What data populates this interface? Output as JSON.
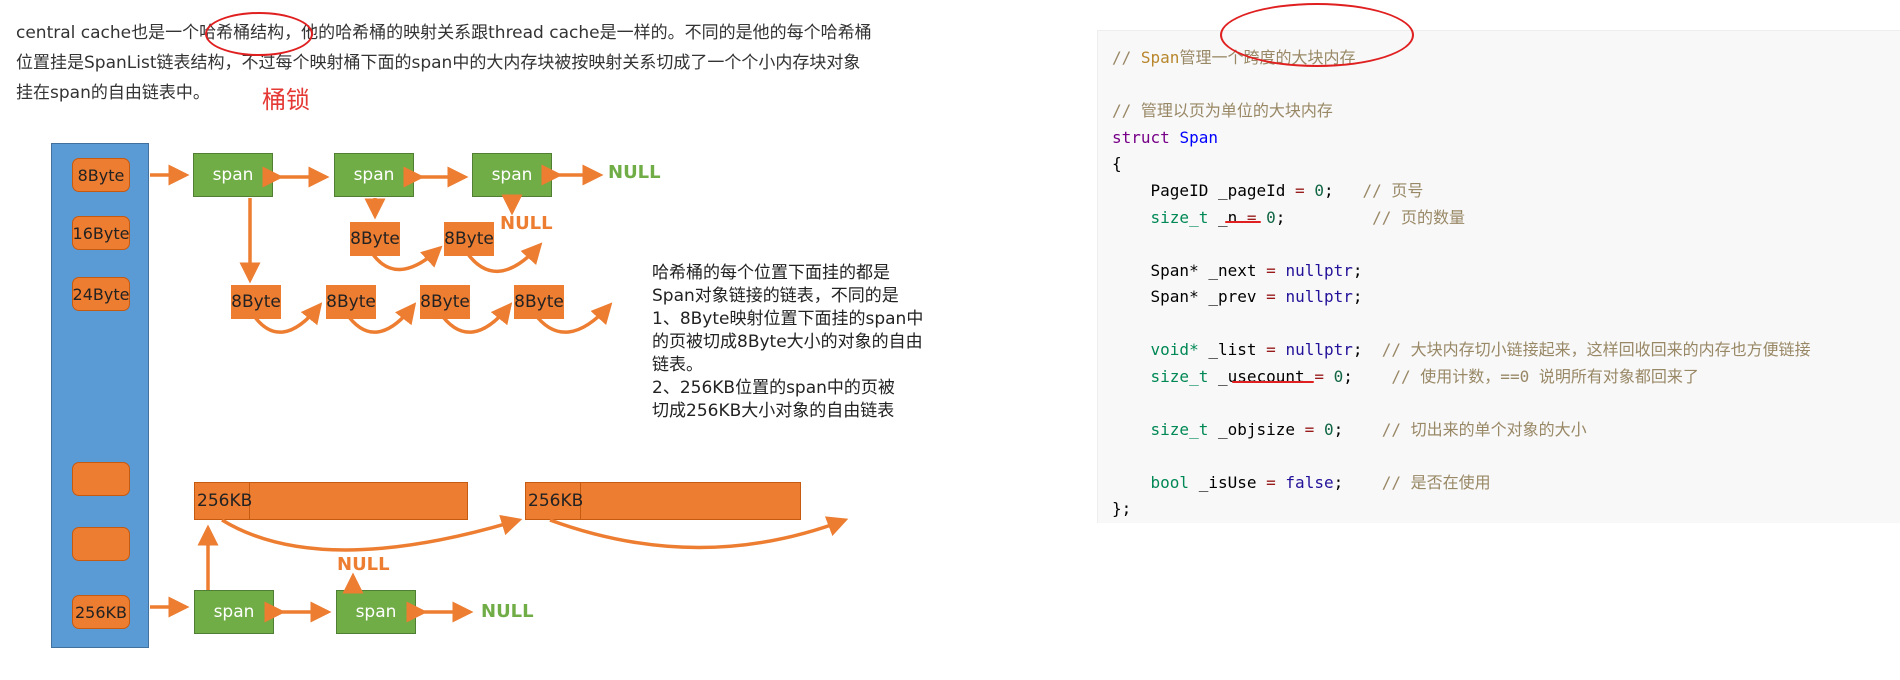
{
  "intro": {
    "line1": "central cache也是一个哈希桶结构，他的哈希桶的映射关系跟thread cache是一样的。不同的是他的每个哈希桶",
    "line2": "位置挂是SpanList链表结构，不过每个映射桶下面的span中的大内存块被按映射关系切成了一个个小内存块对象",
    "line3": "挂在span的自由链表中。",
    "lock_note": "桶锁"
  },
  "diagram": {
    "bucket_slots": [
      "8Byte",
      "16Byte",
      "24Byte",
      "",
      "",
      "256KB"
    ],
    "span_label": "span",
    "null_label": "NULL",
    "object_label": "8Byte",
    "big_block_label": "256KB",
    "explanation": [
      "哈希桶的每个位置下面挂的都是",
      "Span对象链接的链表，不同的是",
      "1、8Byte映射位置下面挂的span中",
      "的页被切成8Byte大小的对象的自由",
      "链表。",
      "2、256KB位置的span中的页被",
      "切成256KB大小对象的自由链表"
    ]
  },
  "code": {
    "line1": {
      "comment_a": "// ",
      "type": "Span",
      "comment_b": "管理一个跨度的大块内存"
    },
    "line3": "// 管理以页为单位的大块内存",
    "line4": {
      "kw": "struct",
      "name": "Span"
    },
    "line5": "{",
    "line6": {
      "type": "PageID",
      "name": "_pageId",
      "op": "=",
      "val": "0",
      "comment": "// 页号"
    },
    "line7": {
      "type": "size_t",
      "name": "_n",
      "op": "=",
      "val": "0",
      "comment": "// 页的数量"
    },
    "line9": {
      "type": "Span*",
      "name": "_next",
      "op": "=",
      "val": "nullptr"
    },
    "line10": {
      "type": "Span*",
      "name": "_prev",
      "op": "=",
      "val": "nullptr"
    },
    "line12": {
      "type": "void*",
      "name": "_list",
      "op": "=",
      "val": "nullptr",
      "comment": "// 大块内存切小链接起来，这样回收回来的内存也方便链接"
    },
    "line13": {
      "type": "size_t",
      "name": "_usecount",
      "op": "=",
      "val": "0",
      "comment": "// 使用计数，==0 说明所有对象都回来了"
    },
    "line15": {
      "type": "size_t",
      "name": "_objsize",
      "op": "=",
      "val": "0",
      "comment": "// 切出来的单个对象的大小"
    },
    "line17": {
      "type": "bool",
      "name": "_isUse",
      "op": "=",
      "val": "false",
      "comment": "// 是否在使用"
    },
    "line18": "};"
  },
  "colors": {
    "bucket": "#5b9bd5",
    "span": "#70ad47",
    "object": "#ed7d31",
    "annotation": "#e02020"
  }
}
